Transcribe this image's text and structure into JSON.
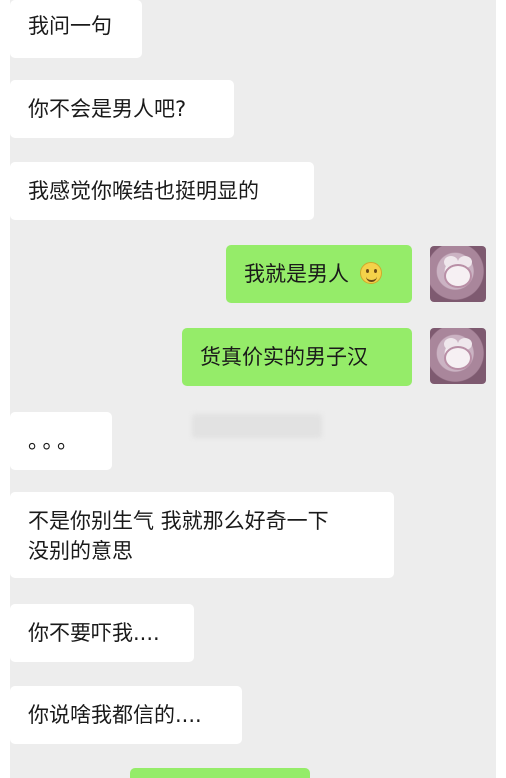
{
  "messages": [
    {
      "text": "我问一句",
      "side": "in"
    },
    {
      "text": "你不会是男人吧?",
      "side": "in"
    },
    {
      "text": "我感觉你喉结也挺明显的",
      "side": "in"
    },
    {
      "text": "我就是男人",
      "side": "out",
      "emoji": "smile-emoji"
    },
    {
      "text": "货真价实的男子汉",
      "side": "out"
    },
    {
      "text": "。。。",
      "side": "in"
    },
    {
      "line1": "不是你别生气 我就那么好奇一下",
      "line2": "没别的意思",
      "side": "in"
    },
    {
      "text": "你不要吓我....",
      "side": "in"
    },
    {
      "text": "你说啥我都信的....",
      "side": "in"
    }
  ],
  "colors": {
    "background": "#ededed",
    "incoming_bubble": "#ffffff",
    "outgoing_bubble": "#95ec69"
  }
}
